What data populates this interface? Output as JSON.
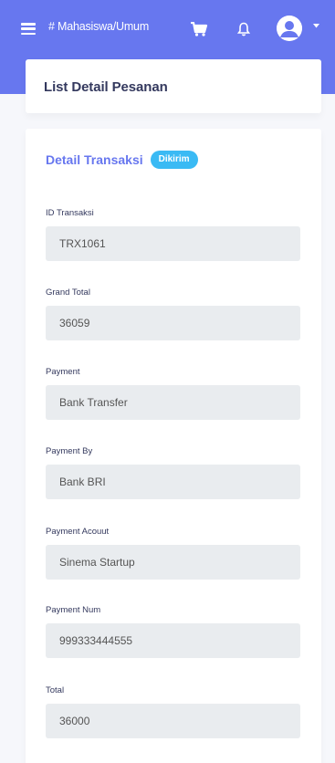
{
  "navbar": {
    "title": "# Mahasiswa/Umum",
    "icons": [
      "menu-icon",
      "cart-icon",
      "bell-icon",
      "avatar-icon",
      "caret-down-icon"
    ],
    "accent": "#6777ef"
  },
  "header": {
    "title": "List Detail Pesanan"
  },
  "detail": {
    "title": "Detail Transaksi",
    "status_badge": "Dikirim",
    "badge_color": "#3abaf4",
    "fields": [
      {
        "label": "ID Transaksi",
        "value": "TRX1061"
      },
      {
        "label": "Grand Total",
        "value": "36059"
      },
      {
        "label": "Payment",
        "value": "Bank Transfer"
      },
      {
        "label": "Payment By",
        "value": "Bank BRI"
      },
      {
        "label": "Payment Acouut",
        "value": "Sinema Startup"
      },
      {
        "label": "Payment Num",
        "value": "999333444555"
      },
      {
        "label": "Total",
        "value": "36000"
      }
    ]
  }
}
